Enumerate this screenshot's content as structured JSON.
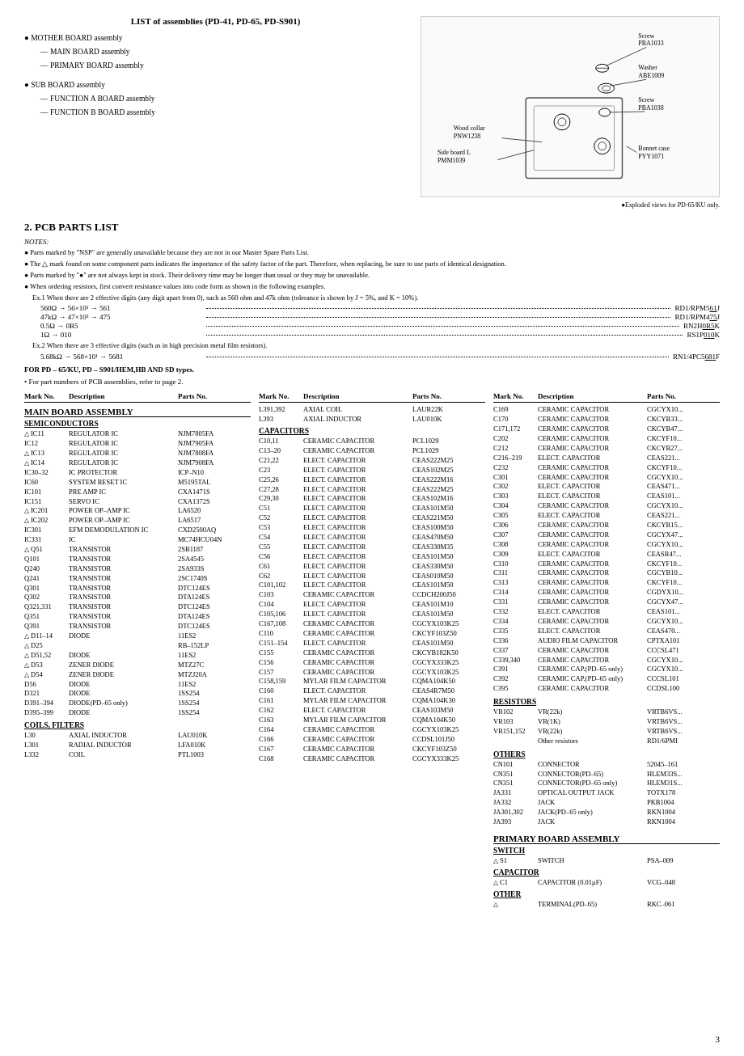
{
  "top": {
    "list_title": "LIST of assemblies (PD-41, PD-65, PD-S901)",
    "mother_board": "MOTHER BOARD assembly",
    "main_board": "— MAIN BOARD assembly",
    "primary_board": "— PRIMARY BOARD assembly",
    "sub_board": "SUB BOARD assembly",
    "function_a": "— FUNCTION A BOARD assembly",
    "function_b": "— FUNCTION B BOARD assembly",
    "exploded_note": "●Exploded views for PD-65/KU only.",
    "diagram_labels": {
      "screw1": "Screw\nPBA1033",
      "washer": "Washer\nABE1009",
      "screw2": "Screw\nPBA1038",
      "wood_collar": "Wood collar\nPNW1238",
      "side_board": "Side board L\nPMM1039",
      "bonnet": "Bonnet case\nPYY1071"
    }
  },
  "section2": {
    "title": "2.  PCB PARTS LIST",
    "notes_title": "NOTES:",
    "notes": [
      "Parts marked by \"NSP\" are generally unavailable because they are not in our Master Spare Parts List.",
      "The △ mark found on some component parts indicates the importance of the safety factor of the part. Therefore, when replacing, be sure to use parts of identical designation.",
      "Parts marked by \"●\" are not always kept in stock. Their delivery time may be longer than usual or they may be unavailable.",
      "When ordering resistors, first convert resistance values into code form as shown in the following examples.",
      "Ex.1 When there are 2 effective digits (any digit apart from 0), such as 560 ohm and 47k ohm (tolerance is shown by J = 5%, and K = 10%).",
      "560Ω → 56×10¹ → 561",
      "47kΩ → 47×10³ → 475",
      "0.5Ω → 0R5",
      "1Ω → 010",
      "Ex.2 When there are 3 effective digits (such as in high precision metal film resistors).",
      "5.68kΩ → 568×10¹ → 5681"
    ],
    "formula1": {
      "left": "560Ω → 56×10¹ → 561",
      "right": "RD1/RPM5[6][1]J"
    },
    "formula2": {
      "left": "47kΩ → 47×10³ → 475",
      "right": "RD1/RPM4[7][5]J"
    },
    "formula3": {
      "left": "0.5Ω → 0R5",
      "right": "RN2H[0][R][5]K"
    },
    "formula4": {
      "left": "1Ω → 010",
      "right": "RS1P[0][1][0]K"
    },
    "formula5": {
      "left": "5.68kΩ → 568×10¹ → 5681",
      "right": "RN1/4PC5[6][8][1]F"
    },
    "for_pd_note": "FOR PD – 65/KU, PD – S901/HEM,HB AND SD types.",
    "for_pd_note2": "• For part numbers of PCB assemblies, refer to page 2."
  },
  "left_col": {
    "header": {
      "mark": "Mark No.",
      "desc": "Description",
      "parts": "Parts No."
    },
    "main_board_title": "MAIN BOARD ASSEMBLY",
    "semiconductors_title": "SEMICONDUCTORS",
    "semiconductors": [
      {
        "mark": "△ IC11",
        "desc": "REGULATOR IC",
        "parts": "NJM7805FA"
      },
      {
        "mark": "IC12",
        "desc": "REGULATOR IC",
        "parts": "NJM7905FA"
      },
      {
        "mark": "△ IC13",
        "desc": "REGULATOR IC",
        "parts": "NJM7808FA"
      },
      {
        "mark": "△ IC14",
        "desc": "REGULATOR IC",
        "parts": "NJM7908FA"
      },
      {
        "mark": "IC30–32",
        "desc": "IC PROTECTOR",
        "parts": "ICP–N10"
      },
      {
        "mark": "",
        "desc": "",
        "parts": ""
      },
      {
        "mark": "IC60",
        "desc": "SYSTEM RESET IC",
        "parts": "M5195TAL"
      },
      {
        "mark": "IC101",
        "desc": "PRE AMP IC",
        "parts": "CXA1471S"
      },
      {
        "mark": "IC151",
        "desc": "SERVO IC",
        "parts": "CXA1372S"
      },
      {
        "mark": "△ IC201",
        "desc": "POWER OP–AMP IC",
        "parts": "LA6520"
      },
      {
        "mark": "△ IC202",
        "desc": "POWER OP–AMP IC",
        "parts": "LA6517"
      },
      {
        "mark": "",
        "desc": "",
        "parts": ""
      },
      {
        "mark": "IC301",
        "desc": "EFM DEMODULATION IC",
        "parts": "CXD2500AQ"
      },
      {
        "mark": "IC331",
        "desc": "IC",
        "parts": "MC74HCU04N"
      },
      {
        "mark": "",
        "desc": "",
        "parts": ""
      },
      {
        "mark": "△ Q51",
        "desc": "TRANSISTOR",
        "parts": "2SB1187"
      },
      {
        "mark": "Q101",
        "desc": "TRANSISTOR",
        "parts": "2SA4545"
      },
      {
        "mark": "Q240",
        "desc": "TRANSISTOR",
        "parts": "2SA933S"
      },
      {
        "mark": "Q241",
        "desc": "TRANSISTOR",
        "parts": "2SC1740S"
      },
      {
        "mark": "Q301",
        "desc": "TRANSISTOR",
        "parts": "DTC124ES"
      },
      {
        "mark": "",
        "desc": "",
        "parts": ""
      },
      {
        "mark": "Q302",
        "desc": "TRANSISTOR",
        "parts": "DTA124ES"
      },
      {
        "mark": "Q321,331",
        "desc": "TRANSISTOR",
        "parts": "DTC124ES"
      },
      {
        "mark": "Q351",
        "desc": "TRANSISTOR",
        "parts": "DTA124ES"
      },
      {
        "mark": "Q391",
        "desc": "TRANSISTOR",
        "parts": "DTC124ES"
      },
      {
        "mark": "",
        "desc": "",
        "parts": ""
      },
      {
        "mark": "△ D11–14",
        "desc": "DIODE",
        "parts": "11ES2"
      },
      {
        "mark": "△ D25",
        "desc": "",
        "parts": "RB–152LP"
      },
      {
        "mark": "△ D51,52",
        "desc": "DIODE",
        "parts": "11ES2"
      },
      {
        "mark": "△ D53",
        "desc": "ZENER DIODE",
        "parts": "MTZ27C"
      },
      {
        "mark": "△ D54",
        "desc": "ZENER DIODE",
        "parts": "MTZ20A"
      },
      {
        "mark": "",
        "desc": "",
        "parts": ""
      },
      {
        "mark": "D56",
        "desc": "DIODE",
        "parts": "11ES2"
      },
      {
        "mark": "D321",
        "desc": "DIODE",
        "parts": "1SS254"
      },
      {
        "mark": "D391–394",
        "desc": "DIODE(PD–65 only)",
        "parts": "1SS254"
      },
      {
        "mark": "D395–399",
        "desc": "DIODE",
        "parts": "1SS254"
      }
    ],
    "coils_title": "COILS, FILTERS",
    "coils": [
      {
        "mark": "L30",
        "desc": "AXIAL INDUCTOR",
        "parts": "LAU010K"
      },
      {
        "mark": "L301",
        "desc": "RADIAL INDUCTOR",
        "parts": "LFA010K"
      },
      {
        "mark": "L332",
        "desc": "COIL",
        "parts": "PTL1003"
      }
    ],
    "col2_header": {
      "mark": "Mark No.",
      "desc": "Description",
      "parts": "Parts No."
    },
    "col2_items": [
      {
        "mark": "L391,392",
        "desc": "AXIAL COIL",
        "parts": "LAUR22K"
      },
      {
        "mark": "L393",
        "desc": "AXIAL INDUCTOR",
        "parts": "LAU010K"
      },
      {
        "mark": "",
        "desc": "",
        "parts": ""
      }
    ],
    "capacitors_title": "CAPACITORS",
    "capacitors": [
      {
        "mark": "C10,11",
        "desc": "CERAMIC CAPACITOR",
        "parts": "PCL1029"
      },
      {
        "mark": "C13–20",
        "desc": "CERAMIC CAPACITOR",
        "parts": "PCL1029"
      },
      {
        "mark": "C21,22",
        "desc": "ELECT. CAPACITOR",
        "parts": "CEAS222M25"
      },
      {
        "mark": "C23",
        "desc": "ELECT. CAPACITOR",
        "parts": "CEAS102M25"
      },
      {
        "mark": "C25,26",
        "desc": "ELECT. CAPACITOR",
        "parts": "CEAS222M16"
      },
      {
        "mark": "",
        "desc": "",
        "parts": ""
      },
      {
        "mark": "C27,28",
        "desc": "ELECT. CAPACITOR",
        "parts": "CEAS222M25"
      },
      {
        "mark": "C29,30",
        "desc": "ELECT. CAPACITOR",
        "parts": "CEAS102M16"
      },
      {
        "mark": "C51",
        "desc": "ELECT. CAPACITOR",
        "parts": "CEAS101M50"
      },
      {
        "mark": "C52",
        "desc": "ELECT. CAPACITOR",
        "parts": "CEAS221M50"
      },
      {
        "mark": "C53",
        "desc": "ELECT. CAPACITOR",
        "parts": "CEAS100M50"
      },
      {
        "mark": "",
        "desc": "",
        "parts": ""
      },
      {
        "mark": "C54",
        "desc": "ELECT. CAPACITOR",
        "parts": "CEAS470M50"
      },
      {
        "mark": "C55",
        "desc": "ELECT. CAPACITOR",
        "parts": "CEAS330M35"
      },
      {
        "mark": "C56",
        "desc": "ELECT. CAPACITOR",
        "parts": "CEAS101M50"
      },
      {
        "mark": "C61",
        "desc": "ELECT. CAPACITOR",
        "parts": "CEAS330M50"
      },
      {
        "mark": "C62",
        "desc": "ELECT. CAPACITOR",
        "parts": "CEAS010M50"
      },
      {
        "mark": "",
        "desc": "",
        "parts": ""
      },
      {
        "mark": "C101,102",
        "desc": "ELECT. CAPACITOR",
        "parts": "CEAS101M50"
      },
      {
        "mark": "C103",
        "desc": "CERAMIC CAPACITOR",
        "parts": "CCDCH200J50"
      },
      {
        "mark": "C104",
        "desc": "ELECT. CAPACITOR",
        "parts": "CEAS101M10"
      },
      {
        "mark": "C105,106",
        "desc": "ELECT. CAPACITOR",
        "parts": "CEAS101M50"
      },
      {
        "mark": "C167,108",
        "desc": "CERAMIC CAPACITOR",
        "parts": "CGCYX103K25"
      },
      {
        "mark": "",
        "desc": "",
        "parts": ""
      },
      {
        "mark": "C110",
        "desc": "CERAMIC CAPACITOR",
        "parts": "CKCYF103Z50"
      },
      {
        "mark": "C151–154",
        "desc": "ELECT. CAPACITOR",
        "parts": "CEAS101M50"
      },
      {
        "mark": "C155",
        "desc": "CERAMIC CAPACITOR",
        "parts": "CKCYB182K50"
      },
      {
        "mark": "C156",
        "desc": "CERAMIC CAPACITOR",
        "parts": "CGCYX333K25"
      },
      {
        "mark": "C157",
        "desc": "CERAMIC CAPACITOR",
        "parts": "CGCYX103K25"
      },
      {
        "mark": "",
        "desc": "",
        "parts": ""
      },
      {
        "mark": "C158,159",
        "desc": "MYLAR FILM CAPACITOR",
        "parts": "CQMA104K50"
      },
      {
        "mark": "C160",
        "desc": "ELECT. CAPACITOR",
        "parts": "CEAS4R7M50"
      },
      {
        "mark": "C161",
        "desc": "MYLAR FILM CAPACITOR",
        "parts": "CQMA104K30"
      },
      {
        "mark": "C162",
        "desc": "ELECT. CAPACITOR",
        "parts": "CEAS103M50"
      },
      {
        "mark": "C163",
        "desc": "MYLAR FILM CAPACITOR",
        "parts": "CQMA104K50"
      },
      {
        "mark": "",
        "desc": "",
        "parts": ""
      },
      {
        "mark": "C164",
        "desc": "CERAMIC CAPACITOR",
        "parts": "CGCYX103K25"
      },
      {
        "mark": "C166",
        "desc": "CERAMIC CAPACITOR",
        "parts": "CCDSL101J50"
      },
      {
        "mark": "C167",
        "desc": "CERAMIC CAPACITOR",
        "parts": "CKCYF103Z50"
      },
      {
        "mark": "C168",
        "desc": "CERAMIC CAPACITOR",
        "parts": "CGCYX333K25"
      }
    ]
  },
  "right_col": {
    "header": {
      "mark": "Mark No.",
      "desc": "Description",
      "parts": "Parts No."
    },
    "items": [
      {
        "mark": "C169",
        "desc": "CERAMIC CAPACITOR",
        "parts": "CGCYX10..."
      },
      {
        "mark": "",
        "desc": "",
        "parts": ""
      },
      {
        "mark": "C170",
        "desc": "CERAMIC CAPACITOR",
        "parts": "CKCYB33..."
      },
      {
        "mark": "C171,172",
        "desc": "CERAMIC CAPACITOR",
        "parts": "CKCYB47..."
      },
      {
        "mark": "C202",
        "desc": "CERAMIC CAPACITOR",
        "parts": "CKCYF10..."
      },
      {
        "mark": "C212",
        "desc": "CERAMIC CAPACITOR",
        "parts": "CKCYB27..."
      },
      {
        "mark": "C216–219",
        "desc": "ELECT. CAPACITOR",
        "parts": "CEAS221..."
      },
      {
        "mark": "",
        "desc": "",
        "parts": ""
      },
      {
        "mark": "C232",
        "desc": "CERAMIC CAPACITOR",
        "parts": "CKCYF10..."
      },
      {
        "mark": "C301",
        "desc": "CERAMIC CAPACITOR",
        "parts": "CGCYX10..."
      },
      {
        "mark": "C302",
        "desc": "ELECT. CAPACITOR",
        "parts": "CEAS471..."
      },
      {
        "mark": "C303",
        "desc": "ELECT. CAPACITOR",
        "parts": "CEAS101..."
      },
      {
        "mark": "C304",
        "desc": "CERAMIC CAPACITOR",
        "parts": "CGCYX10..."
      },
      {
        "mark": "",
        "desc": "",
        "parts": ""
      },
      {
        "mark": "C305",
        "desc": "ELECT. CAPACITOR",
        "parts": "CEAS221..."
      },
      {
        "mark": "C306",
        "desc": "CERAMIC CAPACITOR",
        "parts": "CKCYB15..."
      },
      {
        "mark": "C307",
        "desc": "CERAMIC CAPACITOR",
        "parts": "CGCYX47..."
      },
      {
        "mark": "C308",
        "desc": "CERAMIC CAPACITOR",
        "parts": "CGCYX10..."
      },
      {
        "mark": "C309",
        "desc": "ELECT. CAPACITOR",
        "parts": "CEASR47..."
      },
      {
        "mark": "",
        "desc": "",
        "parts": ""
      },
      {
        "mark": "C310",
        "desc": "CERAMIC CAPACITOR",
        "parts": "CKCYF10..."
      },
      {
        "mark": "C311",
        "desc": "CERAMIC CAPACITOR",
        "parts": "CGCYB10..."
      },
      {
        "mark": "C313",
        "desc": "CERAMIC CAPACITOR",
        "parts": "CKCYF10..."
      },
      {
        "mark": "C314",
        "desc": "CERAMIC CAPACITOR",
        "parts": "CGDYX10..."
      },
      {
        "mark": "C331",
        "desc": "CERAMIC CAPACITOR",
        "parts": "CGCYX47..."
      },
      {
        "mark": "",
        "desc": "",
        "parts": ""
      },
      {
        "mark": "C332",
        "desc": "ELECT. CAPACITOR",
        "parts": "CEAS101..."
      },
      {
        "mark": "C334",
        "desc": "CERAMIC CAPACITOR",
        "parts": "CGCYX10..."
      },
      {
        "mark": "C335",
        "desc": "ELECT. CAPACITOR",
        "parts": "CEAS470..."
      },
      {
        "mark": "C336",
        "desc": "AUDIO FILM CAPACITOR",
        "parts": "CPTXA101"
      },
      {
        "mark": "C337",
        "desc": "CERAMIC CAPACITOR",
        "parts": "CCCSL471"
      },
      {
        "mark": "",
        "desc": "",
        "parts": ""
      },
      {
        "mark": "C339,340",
        "desc": "CERAMIC CAPACITOR",
        "parts": "CGCYX10..."
      },
      {
        "mark": "C391",
        "desc": "CERAMIC CAP.(PD–65 only)",
        "parts": "CGCYX10..."
      },
      {
        "mark": "C392",
        "desc": "CERAMIC CAP.(PD–65 only)",
        "parts": "CCCSL101"
      },
      {
        "mark": "C395",
        "desc": "CERAMIC CAPACITOR",
        "parts": "CCDSL100"
      }
    ],
    "resistors_title": "RESISTORS",
    "resistors": [
      {
        "mark": "VR102",
        "desc": "VR(22k)",
        "parts": "VRTB6VS..."
      },
      {
        "mark": "VR103",
        "desc": "VR(1K)",
        "parts": "VRTB6VS..."
      },
      {
        "mark": "VR151,152",
        "desc": "VR(22k)",
        "parts": "VRTB6VS..."
      },
      {
        "mark": "",
        "desc": "Other resistors",
        "parts": "RD1/6PMI"
      }
    ],
    "others_title": "OTHERS",
    "others": [
      {
        "mark": "CN101",
        "desc": "CONNECTOR",
        "parts": "52045–161"
      },
      {
        "mark": "CN351",
        "desc": "CONNECTOR(PD–65)",
        "parts": "HLEM33S..."
      },
      {
        "mark": "CN351",
        "desc": "CONNECTOR(PD–65 only)",
        "parts": "HLEM31S..."
      },
      {
        "mark": "",
        "desc": "",
        "parts": ""
      },
      {
        "mark": "JA331",
        "desc": "OPTICAL OUTPUT JACK",
        "parts": "TOTX178"
      },
      {
        "mark": "JA332",
        "desc": "JACK",
        "parts": "PKB1004"
      },
      {
        "mark": "JA301,302",
        "desc": "JACK(PD–65 only)",
        "parts": "RKN1004"
      },
      {
        "mark": "JA393",
        "desc": "JACK",
        "parts": "RKN1004"
      }
    ],
    "primary_title": "PRIMARY BOARD ASSEMBLY",
    "switch_title": "SWITCH",
    "switch_items": [
      {
        "mark": "△ S1",
        "desc": "SWITCH",
        "parts": "PSA–009"
      }
    ],
    "capacitor_title": "CAPACITOR",
    "cap_items": [
      {
        "mark": "△ C1",
        "desc": "CAPACITOR (0.01μF)",
        "parts": "VCG–048"
      }
    ],
    "other_title": "OTHER",
    "other_items": [
      {
        "mark": "△",
        "desc": "TERMINAL(PD–65)",
        "parts": "RKC–061"
      }
    ]
  },
  "page_number": "3"
}
